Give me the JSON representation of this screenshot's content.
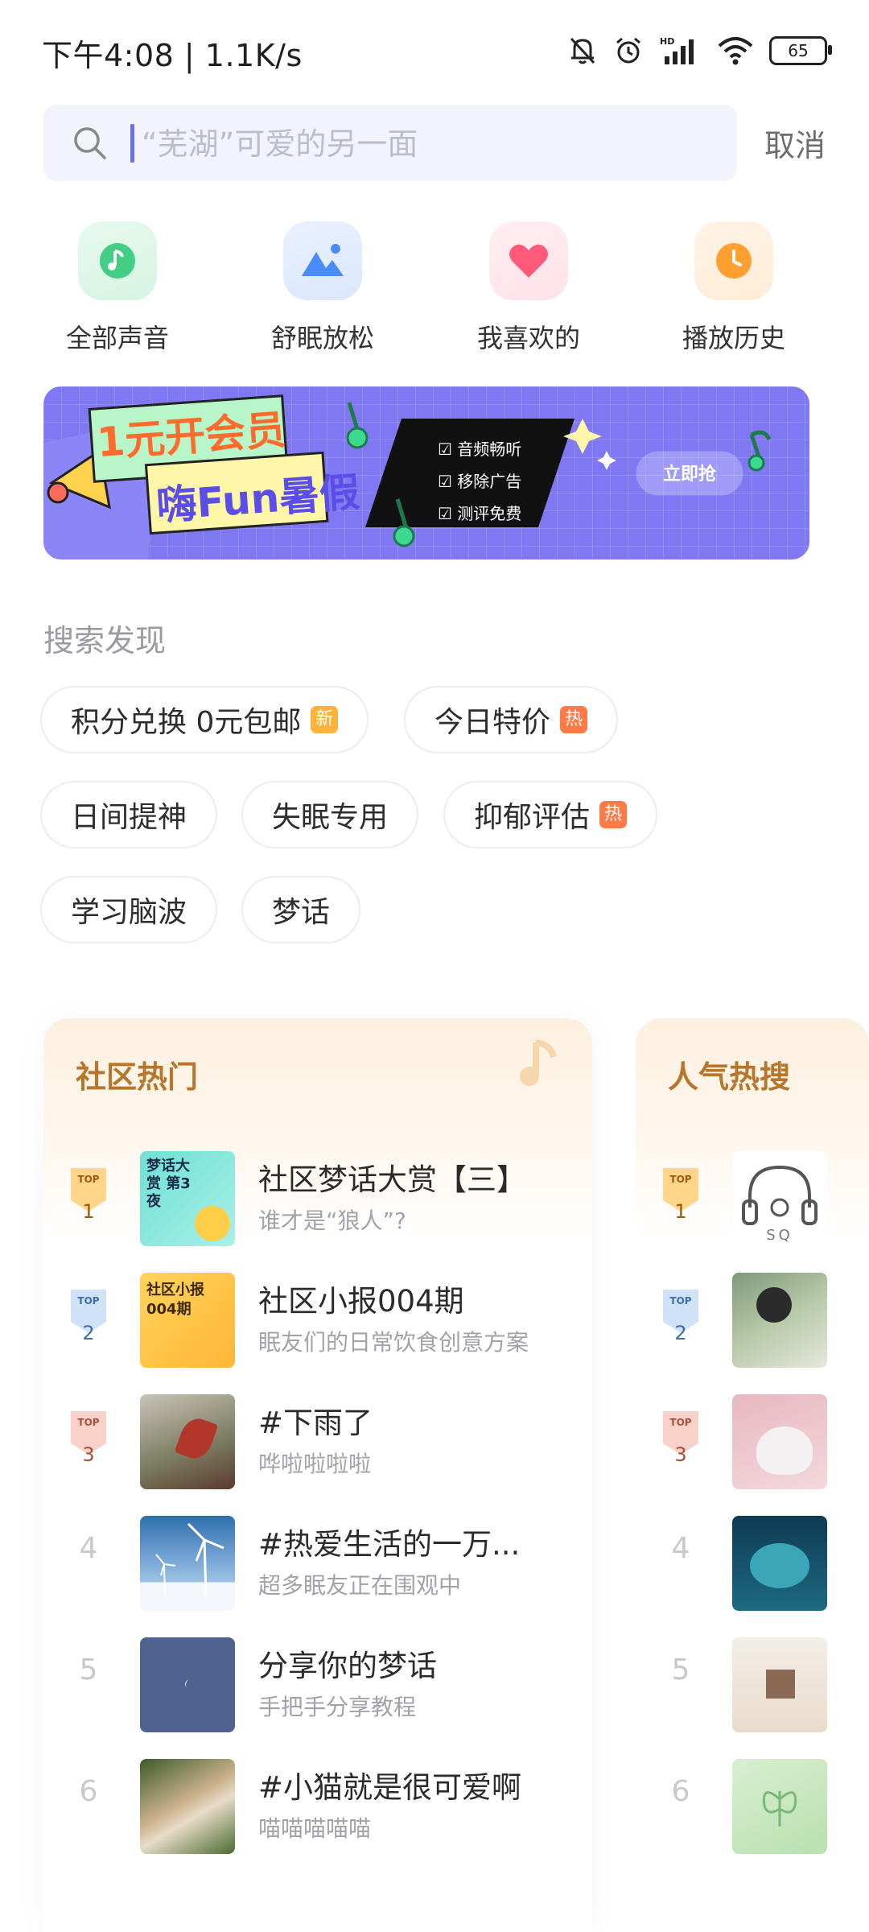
{
  "status": {
    "time": "下午4:08 | 1.1K/s",
    "battery": "65",
    "icons": [
      "bell-off-icon",
      "alarm-icon",
      "hd-signal-icon",
      "wifi-icon",
      "battery-icon"
    ]
  },
  "search": {
    "placeholder": "“芜湖”可爱的另一面",
    "cancel_label": "取消"
  },
  "quick_actions": [
    {
      "label": "全部声音",
      "icon": "music-note-icon",
      "color": "#3dc87a"
    },
    {
      "label": "舒眠放松",
      "icon": "mountain-icon",
      "color": "#4a8cf7"
    },
    {
      "label": "我喜欢的",
      "icon": "heart-icon",
      "color": "#ff5a7a"
    },
    {
      "label": "播放历史",
      "icon": "clock-icon",
      "color": "#ffa030"
    }
  ],
  "banner": {
    "headline1": "1元开会员",
    "headline2": "嗨Fun暑假",
    "features": [
      "音频畅听",
      "移除广告",
      "测评免费"
    ],
    "cta": "立即抢"
  },
  "discover": {
    "title": "搜索发现",
    "chips": [
      {
        "label": "积分兑换 0元包邮",
        "badge": "新",
        "badge_type": "new"
      },
      {
        "label": "今日特价",
        "badge": "热",
        "badge_type": "hot"
      },
      {
        "label": "日间提神",
        "badge": "",
        "badge_type": ""
      },
      {
        "label": "失眠专用",
        "badge": "",
        "badge_type": ""
      },
      {
        "label": "抑郁评估",
        "badge": "热",
        "badge_type": "hot"
      },
      {
        "label": "学习脑波",
        "badge": "",
        "badge_type": ""
      },
      {
        "label": "梦话",
        "badge": "",
        "badge_type": ""
      }
    ]
  },
  "community_hot": {
    "title": "社区热门",
    "items": [
      {
        "rank": "1",
        "title": "社区梦话大赏【三】",
        "subtitle": "谁才是“狼人”?",
        "thumb_text": "梦话大赏 第3夜"
      },
      {
        "rank": "2",
        "title": "社区小报004期",
        "subtitle": "眠友们的日常饮食创意方案",
        "thumb_text": "社区小报 004期"
      },
      {
        "rank": "3",
        "title": "#下雨了",
        "subtitle": "哗啦啦啦啦",
        "thumb_text": ""
      },
      {
        "rank": "4",
        "title": "#热爱生活的一万...",
        "subtitle": "超多眠友正在围观中",
        "thumb_text": ""
      },
      {
        "rank": "5",
        "title": "分享你的梦话",
        "subtitle": "手把手分享教程",
        "thumb_text": ""
      },
      {
        "rank": "6",
        "title": "#小猫就是很可爱啊",
        "subtitle": "喵喵喵喵喵",
        "thumb_text": ""
      }
    ]
  },
  "popular_search": {
    "title": "人气热搜",
    "items": [
      {
        "rank": "1",
        "thumb_text": "SQ"
      },
      {
        "rank": "2",
        "thumb_text": ""
      },
      {
        "rank": "3",
        "thumb_text": ""
      },
      {
        "rank": "4",
        "thumb_text": ""
      },
      {
        "rank": "5",
        "thumb_text": ""
      },
      {
        "rank": "6",
        "thumb_text": ""
      }
    ]
  },
  "colors": {
    "accent": "#6a6df0",
    "panel_title": "#b8762a",
    "banner_bg": "#7f78f2"
  }
}
